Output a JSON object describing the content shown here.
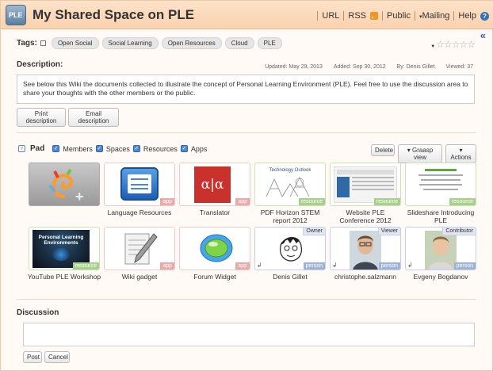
{
  "header": {
    "logo_text": "PLE",
    "title": "My Shared Space on PLE",
    "nav": {
      "url": "URL",
      "rss": "RSS",
      "public": "Public",
      "mailing": "Mailing",
      "help": "Help"
    }
  },
  "tags": {
    "label": "Tags:",
    "items": [
      "Open Social",
      "Social Learning",
      "Open Resources",
      "Cloud",
      "PLE"
    ],
    "rating_stars": 5,
    "rating_value": 0
  },
  "description": {
    "label": "Description:",
    "updated": "Updated:  May 29, 2013",
    "added": "Added:  Sep 30, 2012",
    "by": "By:  Denis Gillet",
    "viewed": "Viewed:  37",
    "text": "See below this Wiki the documents collected to illustrate the concept of Personal Learning Environment (PLE). Feel free to use the discussion area to share your thoughts with the other members or the public.",
    "print_button": "Print description",
    "email_button": "Email description"
  },
  "pad": {
    "label": "Pad",
    "filters": [
      "Members",
      "Spaces",
      "Resources",
      "Apps"
    ],
    "delete_button": "Delete",
    "view_button": "Graasp view",
    "actions_button": "Actions"
  },
  "items": [
    {
      "caption": "",
      "badge": "",
      "role": "",
      "kind": "add"
    },
    {
      "caption": "Language Resources",
      "badge": "app",
      "role": "",
      "kind": "app"
    },
    {
      "caption": "Translator",
      "badge": "app",
      "role": "",
      "kind": "app"
    },
    {
      "caption": "PDF Horizon STEM report 2012",
      "badge": "resource",
      "role": "",
      "kind": "resource"
    },
    {
      "caption": "Website PLE Conference 2012",
      "badge": "resource",
      "role": "",
      "kind": "resource"
    },
    {
      "caption": "Slideshare Introducing PLE",
      "badge": "resource",
      "role": "",
      "kind": "resource"
    },
    {
      "caption": "YouTube PLE Workshop",
      "badge": "resource",
      "role": "",
      "kind": "resource"
    },
    {
      "caption": "Wiki gadget",
      "badge": "app",
      "role": "",
      "kind": "app"
    },
    {
      "caption": "Forum Widget",
      "badge": "app",
      "role": "",
      "kind": "app"
    },
    {
      "caption": "Denis Gillet",
      "badge": "person",
      "role": "Owner",
      "kind": "person"
    },
    {
      "caption": "christophe.salzmann",
      "badge": "person",
      "role": "Viewer",
      "kind": "person"
    },
    {
      "caption": "Evgeny Bogdanov",
      "badge": "person",
      "role": "Contributor",
      "kind": "person"
    }
  ],
  "thumb_text": {
    "translator": "α|α",
    "pdf_header": "Technology Outlook",
    "youtube": "Personal Learning Environments"
  },
  "discussion": {
    "label": "Discussion",
    "post_button": "Post",
    "cancel_button": "Cancel"
  },
  "colors": {
    "header": "#fde2c8",
    "app": "#e8a9a9",
    "resource": "#a9cf8c",
    "person": "#9fb2d8"
  }
}
